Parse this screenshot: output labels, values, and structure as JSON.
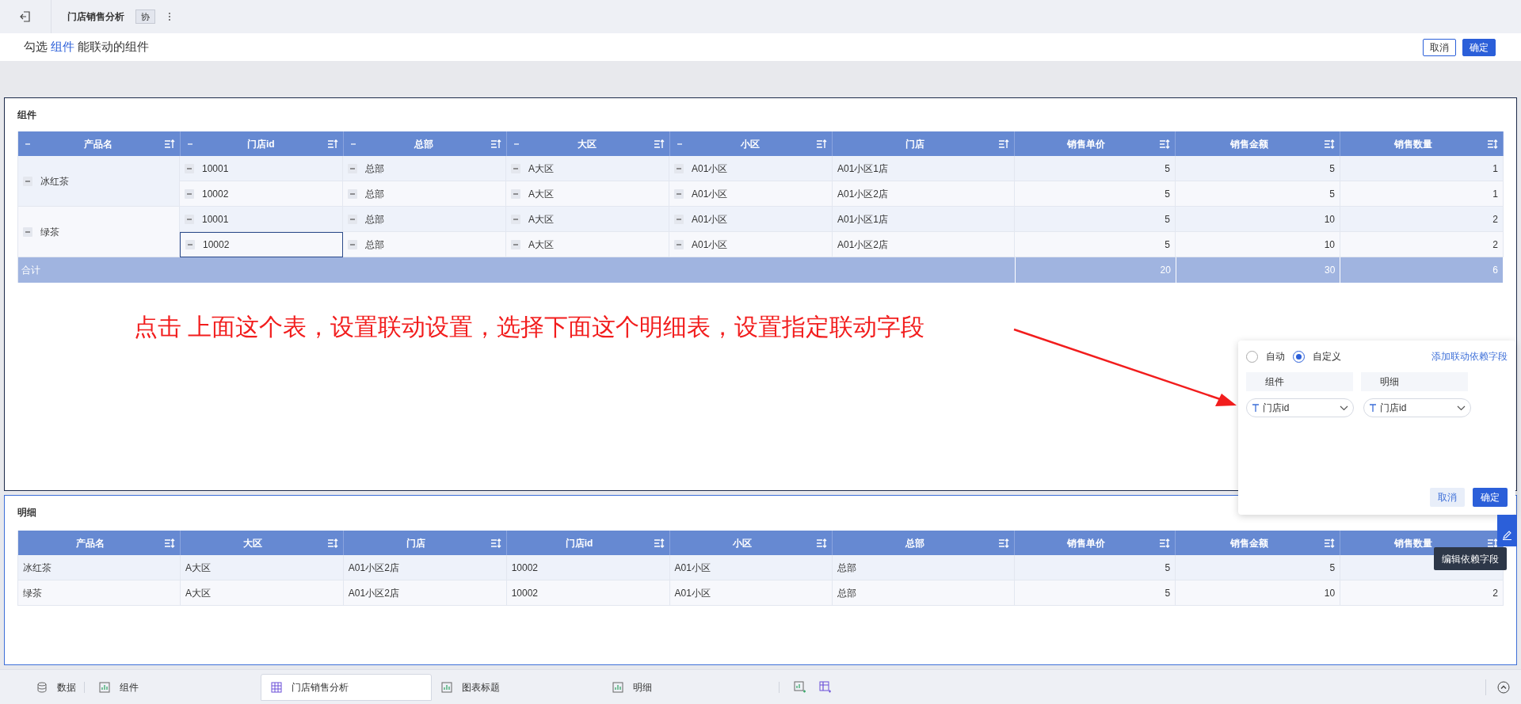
{
  "toolbar": {
    "title": "门店销售分析",
    "badge": "协"
  },
  "hint": {
    "before": "勾选",
    "highlight": "组件",
    "after": "能联动的组件"
  },
  "header_buttons": [
    {
      "label": "取消",
      "kind": "secondary"
    },
    {
      "label": "确定",
      "kind": "primary"
    }
  ],
  "component_panel": {
    "title": "组件",
    "columns": [
      {
        "label": "产品名",
        "collapsible": true,
        "sort_ascending": true
      },
      {
        "label": "门店id",
        "collapsible": true,
        "sort_ascending": true
      },
      {
        "label": "总部",
        "collapsible": true,
        "sort_ascending": true
      },
      {
        "label": "大区",
        "collapsible": true,
        "sort_ascending": true
      },
      {
        "label": "小区",
        "collapsible": true,
        "sort_ascending": true
      },
      {
        "label": "门店",
        "collapsible": false,
        "sort_ascending": true
      },
      {
        "label": "销售单价",
        "collapsible": false,
        "sort_ascending": false
      },
      {
        "label": "销售金额",
        "collapsible": false,
        "sort_ascending": false
      },
      {
        "label": "销售数量",
        "collapsible": false,
        "sort_ascending": false
      }
    ],
    "groups": [
      {
        "product": "冰红茶",
        "rows": [
          {
            "cells": [
              "10001",
              "总部",
              "A大区",
              "A01小区",
              "A01小区1店",
              "5",
              "5",
              "1"
            ],
            "selected": false
          },
          {
            "cells": [
              "10002",
              "总部",
              "A大区",
              "A01小区",
              "A01小区2店",
              "5",
              "5",
              "1"
            ],
            "selected": false
          }
        ]
      },
      {
        "product": "绿茶",
        "rows": [
          {
            "cells": [
              "10001",
              "总部",
              "A大区",
              "A01小区",
              "A01小区1店",
              "5",
              "10",
              "2"
            ],
            "selected": false
          },
          {
            "cells": [
              "10002",
              "总部",
              "A大区",
              "A01小区",
              "A01小区2店",
              "5",
              "10",
              "2"
            ],
            "selected": true
          }
        ]
      }
    ],
    "total": {
      "label": "合计",
      "values": [
        "20",
        "30",
        "6"
      ]
    }
  },
  "annotation": {
    "text": "点击 上面这个表，设置联动设置，选择下面这个明细表，设置指定联动字段"
  },
  "linkage_popup": {
    "modes": [
      {
        "label": "自动",
        "selected": false
      },
      {
        "label": "自定义",
        "selected": true
      }
    ],
    "add_link": "添加联动依赖字段",
    "headers": [
      "组件",
      "明细"
    ],
    "fields": [
      "门店id",
      "门店id"
    ],
    "buttons": [
      {
        "label": "取消",
        "kind": "secondary"
      },
      {
        "label": "确定",
        "kind": "primary"
      }
    ]
  },
  "detail_panel": {
    "title": "明细",
    "columns": [
      {
        "label": "产品名",
        "sort_ascending": false
      },
      {
        "label": "大区",
        "sort_ascending": false
      },
      {
        "label": "门店",
        "sort_ascending": false
      },
      {
        "label": "门店id",
        "sort_ascending": false
      },
      {
        "label": "小区",
        "sort_ascending": false
      },
      {
        "label": "总部",
        "sort_ascending": false
      },
      {
        "label": "销售单价",
        "sort_ascending": false
      },
      {
        "label": "销售金额",
        "sort_ascending": false
      },
      {
        "label": "销售数量",
        "sort_ascending": false
      }
    ],
    "rows": [
      [
        "冰红茶",
        "A大区",
        "A01小区2店",
        "10002",
        "A01小区",
        "总部",
        "5",
        "5"
      ],
      [
        "绿茶",
        "A大区",
        "A01小区2店",
        "10002",
        "A01小区",
        "总部",
        "5",
        "10",
        "2"
      ]
    ]
  },
  "tooltip": "编辑依赖字段",
  "bottom_tabs": [
    {
      "label": "数据",
      "kind": "data",
      "selected": false
    },
    {
      "label": "组件",
      "kind": "chart",
      "selected": false
    },
    {
      "label": "门店销售分析",
      "kind": "table",
      "selected": true
    },
    {
      "label": "图表标题",
      "kind": "chart",
      "selected": false
    },
    {
      "label": "明细",
      "kind": "chart",
      "selected": false
    }
  ]
}
